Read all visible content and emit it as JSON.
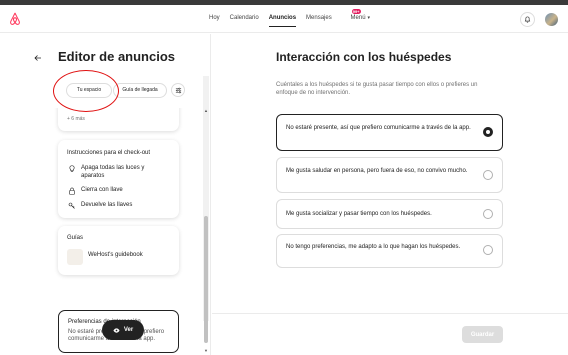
{
  "nav": {
    "items": [
      "Hoy",
      "Calendario",
      "Anuncios",
      "Mensajes",
      "Menú"
    ],
    "active": "Anuncios",
    "messages_badge": "99+"
  },
  "left": {
    "title": "Editor de anuncios",
    "tabs": [
      "Tu espacio",
      "Guía de llegada"
    ],
    "prev_card_more": "+ 6 más",
    "checkout": {
      "title": "Instrucciones para el check-out",
      "items": [
        "Apaga todas las luces y aparatos",
        "Cierra con llave",
        "Devuelve las llaves"
      ]
    },
    "guides": {
      "title": "Guías",
      "item": "WeHost's guidebook"
    },
    "preference": {
      "title": "Preferencias de interacción",
      "body": "No estaré presente, así que prefiero comunicarme a través de la app."
    },
    "view_button": "Ver"
  },
  "right": {
    "title": "Interacción con los huéspedes",
    "description": "Cuéntales a los huéspedes si te gusta pasar tiempo con ellos o prefieres un enfoque de no intervención.",
    "options": [
      {
        "text": "No estaré presente, así que prefiero comunicarme a través de la app.",
        "selected": true
      },
      {
        "text": "Me gusta saludar en persona, pero fuera de eso, no convivo mucho.",
        "selected": false
      },
      {
        "text": "Me gusta socializar y pasar tiempo con los huéspedes.",
        "selected": false
      },
      {
        "text": "No tengo preferencias, me adapto a lo que hagan los huéspedes.",
        "selected": false
      }
    ],
    "save_button": "Guardar"
  },
  "colors": {
    "brand": "#FF385C",
    "annotation": "#E01010",
    "primary_dark": "#222222",
    "disabled": "#DDDDDD"
  },
  "icons": [
    "airbnb-logo-icon",
    "bell-icon",
    "back-arrow-icon",
    "filter-icon",
    "lightbulb-icon",
    "lock-icon",
    "keys-icon",
    "eye-icon"
  ]
}
